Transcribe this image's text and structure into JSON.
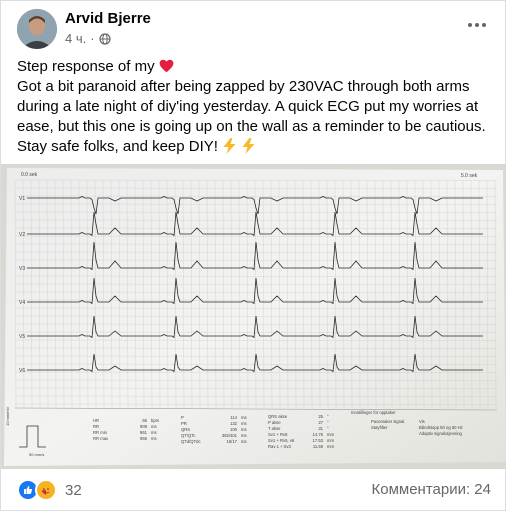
{
  "post": {
    "author": "Arvid Bjerre",
    "time": "4 ч.",
    "privacy_icon": "globe-icon",
    "text_line1": "Step response of my",
    "text_line1_emoji": "heart",
    "text_body": "Got a bit paranoid after being zapped by 230VAC through both arms during a late night of diy'ing yesterday. A quick ECG put my worries at ease, but this one is going up on the wall as a reminder to be cautious. Stay safe folks, and keep DIY!",
    "text_end_emoji": "lightning-icons",
    "reactions_count": "32",
    "comments_label": "Комментарии: 24"
  },
  "ecg": {
    "time_start": "0.0 sek",
    "time_end": "5.0 sek",
    "leads": [
      "V1",
      "V2",
      "V3",
      "V4",
      "V5",
      "V6"
    ],
    "calibration": {
      "mm_mv": "10 mm/mV",
      "speed": "50 mm/s"
    },
    "measurements_col1": [
      {
        "k": "HR",
        "v": "66",
        "u": "bpm"
      },
      {
        "k": "RR",
        "v": "909",
        "u": "ms"
      },
      {
        "k": "RR min",
        "v": "861",
        "u": "ms"
      },
      {
        "k": "RR max",
        "v": "956",
        "u": "ms"
      }
    ],
    "measurements_col2": [
      {
        "k": "P",
        "v": "114",
        "u": "ms"
      },
      {
        "k": "PR",
        "v": "132",
        "u": "ms"
      },
      {
        "k": "QRS",
        "v": "100",
        "u": "ms"
      },
      {
        "k": "QT/QTc",
        "v": "382/401",
        "u": "ms"
      },
      {
        "k": "QTd/QTdc",
        "v": "16/17",
        "u": "ms"
      }
    ],
    "measurements_col3": [
      {
        "k": "QRS akse",
        "v": "25",
        "u": "°"
      },
      {
        "k": "P akse",
        "v": "27",
        "u": "°"
      },
      {
        "k": "T akse",
        "v": "31",
        "u": "°"
      },
      {
        "k": "Sv1 + Rv6",
        "v": "14.76",
        "u": "mm"
      },
      {
        "k": "Sv1 + Rv5, v6",
        "v": "17.53",
        "u": "mm"
      },
      {
        "k": "Rav L + Sv3",
        "v": "11.59",
        "u": "mm"
      }
    ],
    "settings_title": "Innstillinger for opptaker",
    "settings": [
      {
        "k": "Pacemaker signal",
        "v": "Vis"
      },
      {
        "k": "Støyfilter",
        "v": "Båndstopp 50 og 60 Hz"
      },
      {
        "k": "",
        "v": "Adaptiv signalutjevning"
      }
    ]
  }
}
